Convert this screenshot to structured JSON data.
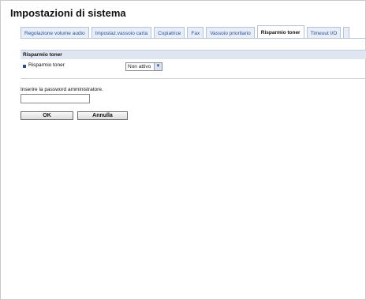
{
  "page": {
    "title": "Impostazioni di sistema"
  },
  "tabs": [
    {
      "label": "Regolazione volume audio",
      "active": false
    },
    {
      "label": "Impostaz.vassoio carta",
      "active": false
    },
    {
      "label": "Copiatrice",
      "active": false
    },
    {
      "label": "Fax",
      "active": false
    },
    {
      "label": "Vassoio prioritario",
      "active": false
    },
    {
      "label": "Risparmio toner",
      "active": true
    },
    {
      "label": "Timeout I/O",
      "active": false
    }
  ],
  "section": {
    "title": "Risparmio toner",
    "setting": {
      "label": "Risparmio toner",
      "value": "Non attivo"
    }
  },
  "password": {
    "label": "Inserire la password amministratore.",
    "value": ""
  },
  "buttons": {
    "ok": "OK",
    "cancel": "Annulla"
  },
  "colors": {
    "tab_text": "#2a4f9a",
    "section_bg": "#dfe6f2",
    "bullet": "#2b4a9a"
  }
}
